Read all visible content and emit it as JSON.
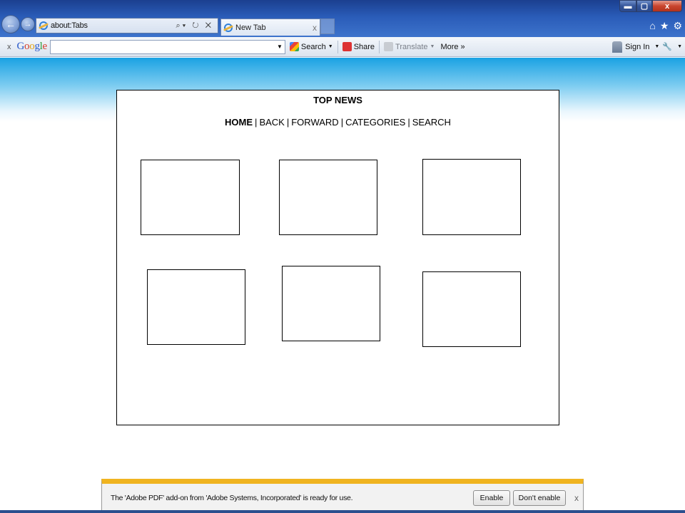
{
  "window": {
    "controls": {
      "minimize": "▬",
      "maximize": "▢",
      "close": "x"
    }
  },
  "navigation": {
    "back_glyph": "←",
    "forward_glyph": "→"
  },
  "address_bar": {
    "url": "about:Tabs",
    "tools": "⌕▾ ↻ ✕"
  },
  "tabs": [
    {
      "label": "New Tab",
      "close": "x"
    }
  ],
  "browser_icons": {
    "home": "⌂",
    "favorites": "★",
    "tools": "⚙"
  },
  "google_toolbar": {
    "close": "x",
    "logo": [
      "G",
      "o",
      "o",
      "g",
      "l",
      "e"
    ],
    "search_value": "",
    "search_label": "Search",
    "share_label": "Share",
    "translate_label": "Translate",
    "more_label": "More »",
    "signin_label": "Sign In",
    "wrench": "🔧"
  },
  "page": {
    "title": "TOP NEWS",
    "nav": [
      "HOME",
      "BACK",
      "FORWARD",
      "CATEGORIES",
      "SEARCH"
    ],
    "nav_separator": "|"
  },
  "notification": {
    "message": "The 'Adobe PDF' add-on from 'Adobe Systems, Incorporated' is ready for use.",
    "enable_label": "Enable",
    "dont_enable_label": "Don't enable",
    "close": "x"
  }
}
